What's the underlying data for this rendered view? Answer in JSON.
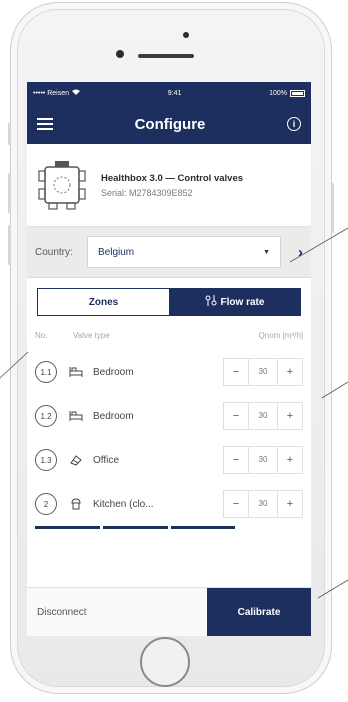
{
  "status": {
    "carrier": "••••• Reisen",
    "time": "9:41",
    "battery": "100%"
  },
  "nav": {
    "title": "Configure"
  },
  "device": {
    "name": "Healthbox 3.0 — Control valves",
    "serial": "Serial: M2784309E852"
  },
  "country": {
    "label": "Country:",
    "value": "Belgium"
  },
  "tabs": {
    "zones": "Zones",
    "flow": "Flow rate"
  },
  "table": {
    "col_no": "No.",
    "col_type": "Valve type",
    "col_qnom": "Qnom [m³/h]",
    "rows": [
      {
        "no": "1.1",
        "type": "Bedroom",
        "value": "30",
        "icon": "bed-icon"
      },
      {
        "no": "1.2",
        "type": "Bedroom",
        "value": "30",
        "icon": "bed-icon"
      },
      {
        "no": "1.3",
        "type": "Office",
        "value": "30",
        "icon": "office-icon"
      },
      {
        "no": "2",
        "type": "Kitchen (clo...",
        "value": "30",
        "icon": "kitchen-icon"
      }
    ]
  },
  "stepper": {
    "minus": "−",
    "plus": "+"
  },
  "footer": {
    "disconnect": "Disconnect",
    "calibrate": "Calibrate"
  },
  "colors": {
    "primary": "#1d2f5e",
    "background": "#ffffff",
    "country_bar": "#ebebeb"
  }
}
